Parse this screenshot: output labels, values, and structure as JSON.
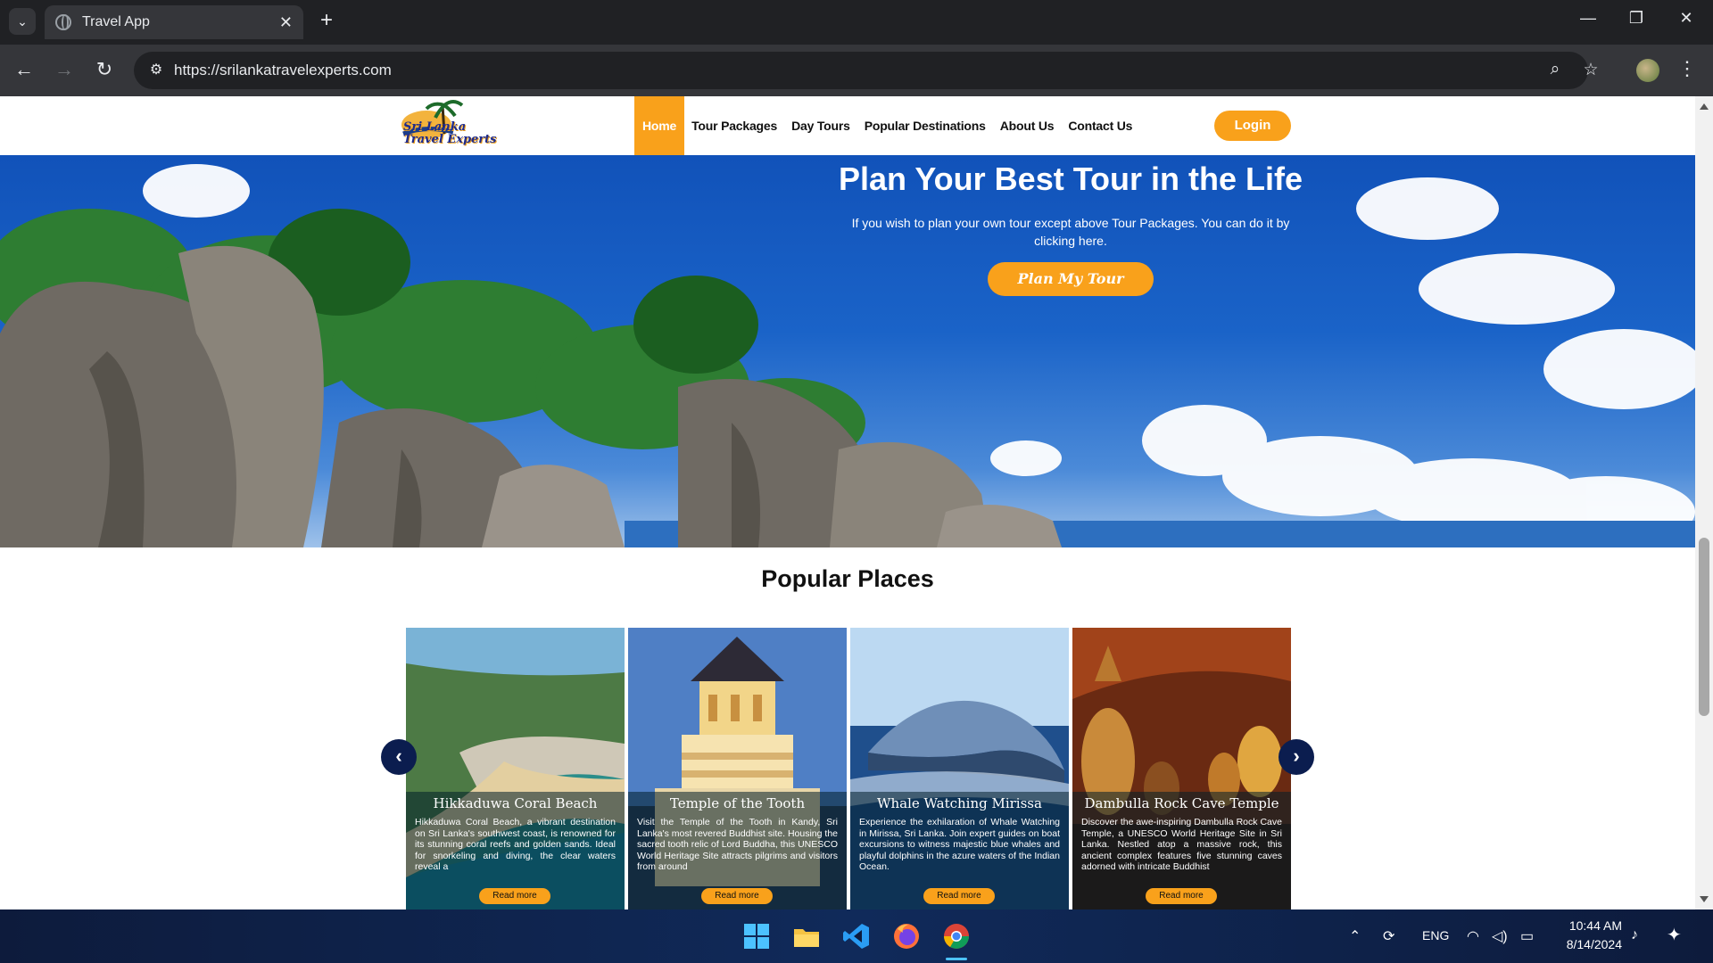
{
  "browser": {
    "tab_title": "Travel App",
    "url": "https://srilankatravelexperts.com"
  },
  "site": {
    "logo_line1": "Sri Lanka",
    "logo_line2": "Travel Experts",
    "nav": [
      "Home",
      "Tour Packages",
      "Day Tours",
      "Popular Destinations",
      "About Us",
      "Contact Us"
    ],
    "login_label": "Login"
  },
  "hero": {
    "title": "Plan Your Best Tour in the Life",
    "subtitle": "If you wish to plan your own tour except above Tour Packages. You can do it by clicking here.",
    "button_label": "Plan My Tour"
  },
  "popular": {
    "title": "Popular Places",
    "cards": [
      {
        "title": "Hikkaduwa Coral Beach",
        "description": "Hikkaduwa Coral Beach, a vibrant destination on Sri Lanka's southwest coast, is renowned for its stunning coral reefs and golden sands. Ideal for snorkeling and diving, the clear waters reveal a",
        "button": "Read more"
      },
      {
        "title": "Temple of the Tooth",
        "description": "Visit the Temple of the Tooth in Kandy, Sri Lanka's most revered Buddhist site. Housing the sacred tooth relic of Lord Buddha, this UNESCO World Heritage Site attracts pilgrims and visitors from around",
        "button": "Read more"
      },
      {
        "title": "Whale Watching Mirissa",
        "description": "Experience the exhilaration of Whale Watching in Mirissa, Sri Lanka. Join expert guides on boat excursions to witness majestic blue whales and playful dolphins in the azure waters of the Indian Ocean.",
        "button": "Read more"
      },
      {
        "title": "Dambulla Rock Cave Temple",
        "description": "Discover the awe-inspiring Dambulla Rock Cave Temple, a UNESCO World Heritage Site in Sri Lanka. Nestled atop a massive rock, this ancient complex features five stunning caves adorned with intricate Buddhist",
        "button": "Read more"
      }
    ]
  },
  "taskbar": {
    "language": "ENG",
    "time": "10:44 AM",
    "date": "8/14/2024"
  },
  "icons": {
    "prev": "chevron-left-icon",
    "next": "chevron-right-icon"
  }
}
